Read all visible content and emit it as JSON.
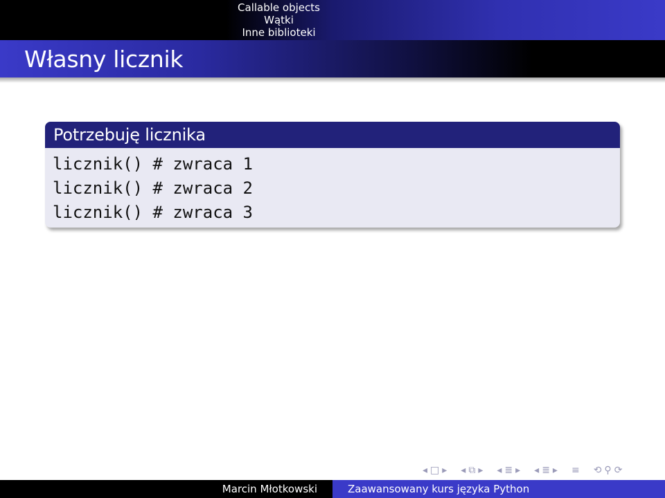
{
  "header": {
    "sections": [
      "Callable objects",
      "Wątki",
      "Inne biblioteki"
    ],
    "frame_title": "Własny licznik"
  },
  "block": {
    "title": "Potrzebuję licznika",
    "code_lines": [
      "licznik() # zwraca 1",
      "licznik() # zwraca 2",
      "licznik() # zwraca 3"
    ]
  },
  "navigation": {
    "icons": [
      "arrow-left-icon",
      "frame-icon",
      "arrow-right-icon",
      "arrow-left-icon",
      "subsection-icon",
      "arrow-right-icon",
      "arrow-left-icon",
      "section-icon",
      "arrow-right-icon",
      "arrow-left-icon",
      "section-icon",
      "arrow-right-icon",
      "align-icon",
      "search-icon",
      "back-icon"
    ]
  },
  "footer": {
    "author": "Marcin Młotkowski",
    "course_title": "Zaawansowany kurs języka Python"
  }
}
